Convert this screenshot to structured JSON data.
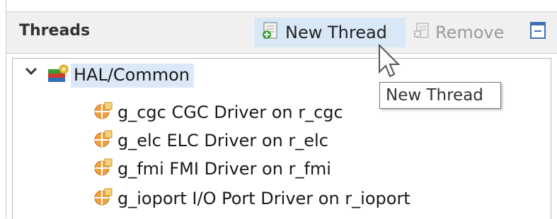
{
  "panel": {
    "title": "Threads",
    "toolbar": {
      "new_thread_label": "New Thread",
      "remove_label": "Remove"
    }
  },
  "tree": {
    "root": {
      "label": "HAL/Common",
      "icon": "hal-common-icon"
    },
    "children": [
      {
        "label": "g_cgc CGC Driver on r_cgc",
        "icon": "driver-module-icon"
      },
      {
        "label": "g_elc ELC Driver on r_elc",
        "icon": "driver-module-icon"
      },
      {
        "label": "g_fmi FMI Driver on r_fmi",
        "icon": "driver-module-icon"
      },
      {
        "label": "g_ioport I/O Port Driver on r_ioport",
        "icon": "driver-module-icon"
      }
    ]
  },
  "tooltip": {
    "text": "New Thread"
  },
  "colors": {
    "header_bg": "#f0f0f0",
    "selection_bg": "#dbe8f8",
    "hover_bg": "#d9e8f7",
    "disabled_text": "#9a9a9a"
  }
}
